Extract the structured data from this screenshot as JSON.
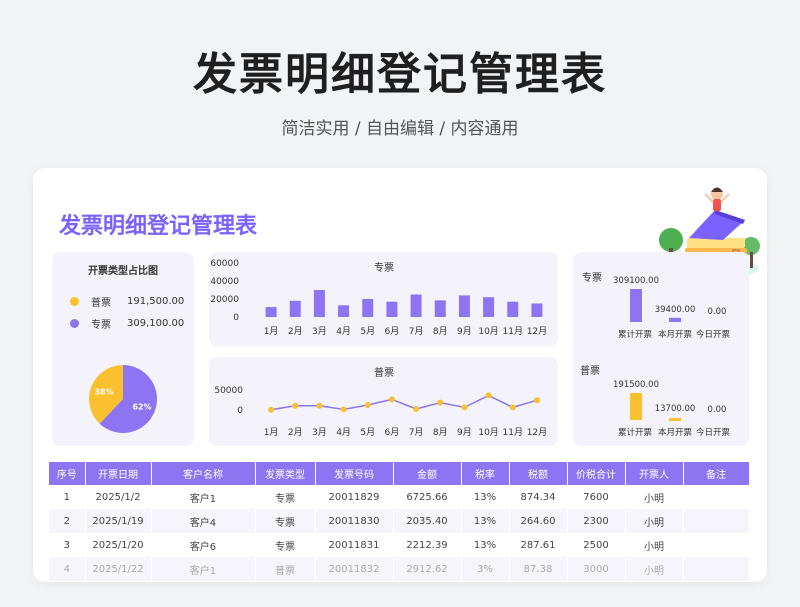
{
  "page": {
    "title": "发票明细登记管理表",
    "subtitle": "简洁实用 / 自由编辑 / 内容通用"
  },
  "card": {
    "title": "发票明细登记管理表"
  },
  "colors": {
    "accent": "#7b61ff",
    "purple": "#8c74f2",
    "yellow": "#fbc02d",
    "header": "#8c74f2"
  },
  "pie": {
    "title": "开票类型占比图",
    "items": [
      {
        "label": "普票",
        "value": "191,500.00",
        "pct": "38%",
        "fraction": 0.38,
        "color": "#fbc02d"
      },
      {
        "label": "专票",
        "value": "309,100.00",
        "pct": "62%",
        "fraction": 0.62,
        "color": "#8c74f2"
      }
    ]
  },
  "chart_data": [
    {
      "type": "bar",
      "title": "专票",
      "categories": [
        "1月",
        "2月",
        "3月",
        "4月",
        "5月",
        "6月",
        "7月",
        "8月",
        "9月",
        "10月",
        "11月",
        "12月"
      ],
      "values": [
        11000,
        18000,
        30000,
        13000,
        20000,
        17000,
        25000,
        18500,
        24000,
        22000,
        17000,
        15000
      ],
      "ylim": [
        0,
        60000
      ],
      "yticks": [
        "60000",
        "40000",
        "20000",
        "0"
      ]
    },
    {
      "type": "line",
      "title": "普票",
      "categories": [
        "1月",
        "2月",
        "3月",
        "4月",
        "5月",
        "6月",
        "7月",
        "8月",
        "9月",
        "10月",
        "11月",
        "12月"
      ],
      "values": [
        4000,
        9000,
        9000,
        4500,
        10000,
        17000,
        5000,
        13000,
        7000,
        22000,
        7000,
        16000
      ],
      "ylim": [
        0,
        100000
      ],
      "yticks": [
        "50000",
        "0"
      ]
    }
  ],
  "kpi": {
    "zhuan": {
      "label": "专票",
      "bars": [
        {
          "label": "累计开票",
          "value": "309100.00",
          "num": 309100
        },
        {
          "label": "本月开票",
          "value": "39400.00",
          "num": 39400
        },
        {
          "label": "今日开票",
          "value": "0.00",
          "num": 0
        }
      ]
    },
    "pu": {
      "label": "普票",
      "bars": [
        {
          "label": "累计开票",
          "value": "191500.00",
          "num": 191500
        },
        {
          "label": "本月开票",
          "value": "13700.00",
          "num": 13700
        },
        {
          "label": "今日开票",
          "value": "0.00",
          "num": 0
        }
      ]
    }
  },
  "table": {
    "headers": [
      "序号",
      "开票日期",
      "客户名称",
      "发票类型",
      "发票号码",
      "金额",
      "税率",
      "税额",
      "价税合计",
      "开票人",
      "备注"
    ],
    "rows": [
      [
        "1",
        "2025/1/2",
        "客户1",
        "专票",
        "20011829",
        "6725.66",
        "13%",
        "874.34",
        "7600",
        "小明",
        ""
      ],
      [
        "2",
        "2025/1/19",
        "客户4",
        "专票",
        "20011830",
        "2035.40",
        "13%",
        "264.60",
        "2300",
        "小明",
        ""
      ],
      [
        "3",
        "2025/1/20",
        "客户6",
        "专票",
        "20011831",
        "2212.39",
        "13%",
        "287.61",
        "2500",
        "小明",
        ""
      ],
      [
        "4",
        "2025/1/22",
        "客户1",
        "普票",
        "20011832",
        "2912.62",
        "3%",
        "87.38",
        "3000",
        "小明",
        ""
      ]
    ]
  }
}
